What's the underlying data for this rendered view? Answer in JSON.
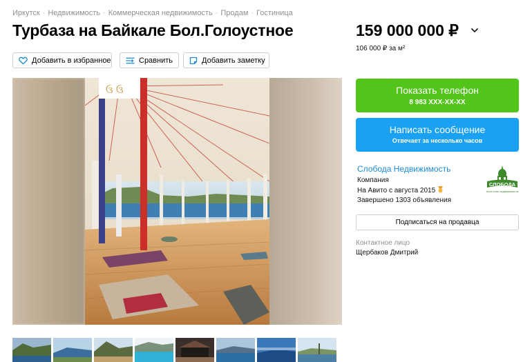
{
  "breadcrumbs": [
    "Иркутск",
    "Недвижимость",
    "Коммерческая недвижимость",
    "Продам",
    "Гостиница"
  ],
  "title": "Турбаза на Байкале Бол.Голоустное",
  "price": {
    "main": "159 000 000 ₽",
    "per_m2": "106 000 ₽ за м²"
  },
  "actions": {
    "favorite": "Добавить в избранное",
    "compare": "Сравнить",
    "note": "Добавить заметку"
  },
  "contact_buttons": {
    "phone_label": "Показать телефон",
    "phone_number": "8 983 XXX-XX-XX",
    "message_label": "Написать сообщение",
    "message_sub": "Отвечает за несколько часов"
  },
  "seller": {
    "name": "Слобода Недвижимость",
    "type": "Компания",
    "since": "На Авито с августа 2015",
    "completed": "Завершено 1303 объявления",
    "subscribe": "Подписаться на продавца",
    "logo_text": "СЛОБОДА",
    "logo_subtext": "Агентство недвижимости"
  },
  "contact_person": {
    "label": "Контактное лицо",
    "name": "Щербаков Дмитрий"
  },
  "colors": {
    "green": "#52c41a",
    "blue": "#1ba1f2",
    "link": "#1a8bd8"
  },
  "thumbnail_count": 8
}
